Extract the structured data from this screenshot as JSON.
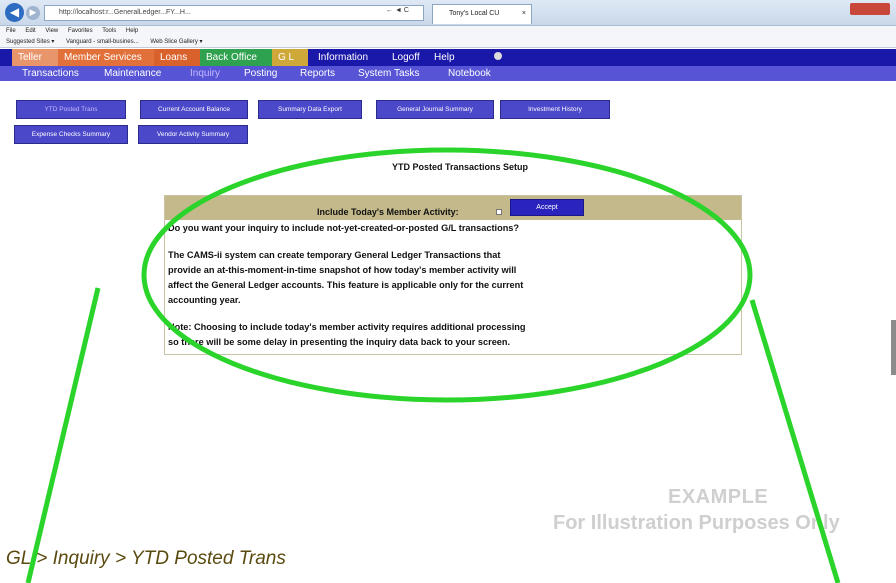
{
  "browser": {
    "address": "http://localhost:r...GeneralLedger...FY...H...",
    "controls": "← ◄ C",
    "tab_title": "Tony's Local CU",
    "tab_close": "×",
    "menu": [
      "File",
      "Edit",
      "View",
      "Favorites",
      "Tools",
      "Help"
    ],
    "favorites": [
      "Suggested Sites ▾",
      "Vanguard - small-busines...",
      "Web Slice Gallery ▾"
    ]
  },
  "nav_top": [
    {
      "label": "Teller",
      "color": "#e8956b"
    },
    {
      "label": "Member Services",
      "color": "#e2703a"
    },
    {
      "label": "Loans",
      "color": "#d9622c"
    },
    {
      "label": "Back Office",
      "color": "#2fa24f"
    },
    {
      "label": "G L",
      "color": "#cfa83a"
    },
    {
      "label": "Information",
      "color": ""
    },
    {
      "label": "Logoff",
      "color": ""
    },
    {
      "label": "Help",
      "color": ""
    }
  ],
  "nav_sub": [
    "Transactions",
    "Maintenance",
    "Inquiry",
    "Posting",
    "Reports",
    "System Tasks",
    "Notebook"
  ],
  "buttons_row1": [
    "YTD Posted Trans",
    "Current Account Balance",
    "Summary Data Export",
    "General Journal Summary",
    "Investment History"
  ],
  "buttons_row2": [
    "Expense Checks Summary",
    "Vendor Activity Summary"
  ],
  "setup_title": "YTD Posted Transactions Setup",
  "panel": {
    "include_label": "Include Today's Member Activity:",
    "accept_label": "Accept",
    "question": "Do you want your inquiry to include not-yet-created-or-posted G/L transactions?",
    "desc_lines": [
      "The CAMS-ii system can create temporary General Ledger Transactions that",
      "provide an at-this-moment-in-time snapshot of how today's member activity will",
      "affect the General Ledger accounts. This feature is applicable only for the current",
      "accounting year."
    ],
    "note_lines": [
      "Note: Choosing to include today's member activity requires additional processing",
      "so there will be some delay in presenting the inquiry data back to your screen."
    ]
  },
  "watermark": {
    "line1": "EXAMPLE",
    "line2": "For Illustration Purposes Only"
  },
  "breadcrumb": "GL > Inquiry > YTD Posted Trans",
  "colors": {
    "nav_top_bg": "#1a18a8",
    "nav_sub_bg": "#5754d6",
    "button_bg": "#4b48c9",
    "accept_bg": "#2a23bd",
    "panel_header": "#c4b98a",
    "annotation_green": "#2bd42b"
  }
}
